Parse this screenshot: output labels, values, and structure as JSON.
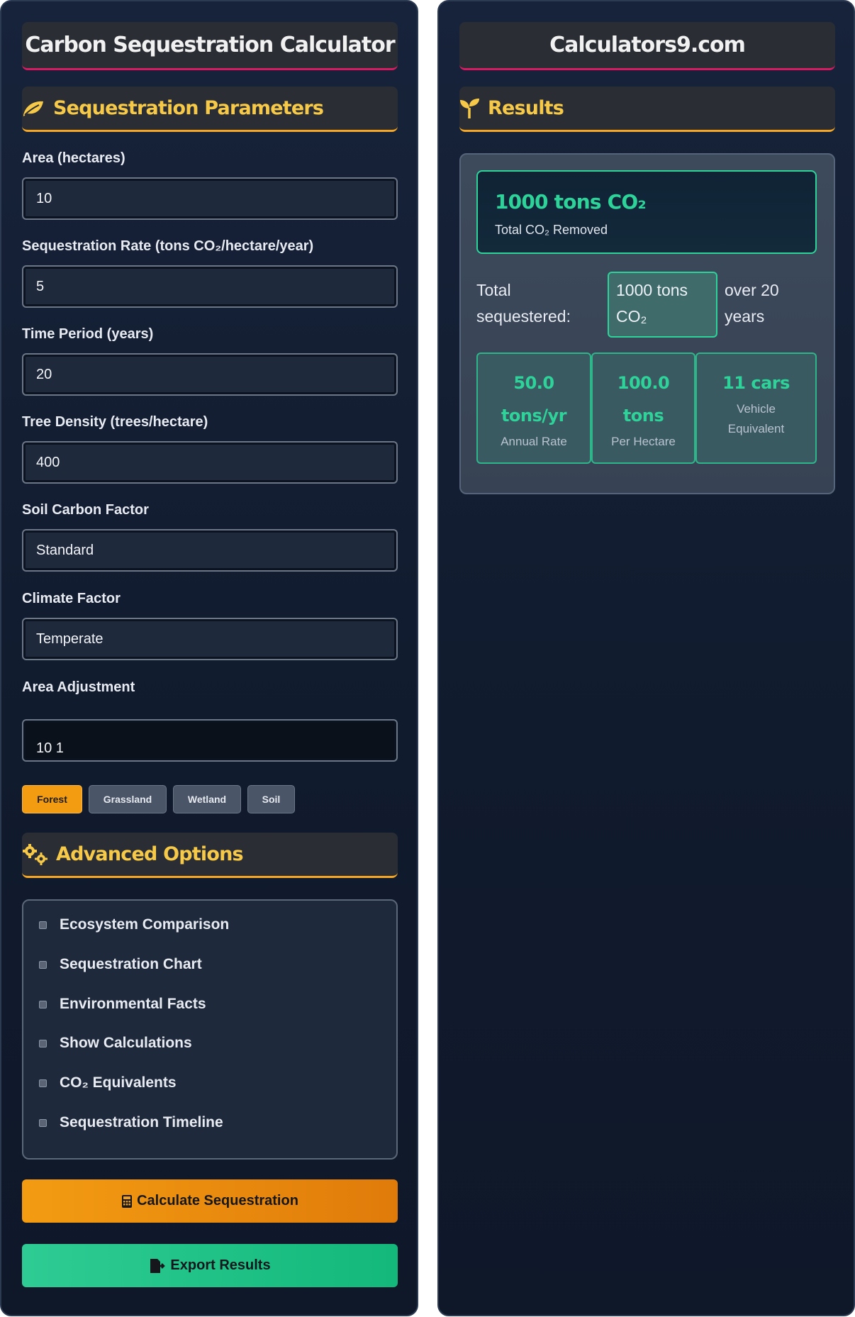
{
  "left": {
    "title": "Carbon Sequestration Calculator",
    "params_heading": "Sequestration Parameters",
    "fields": [
      {
        "label": "Area (hectares)",
        "value": "10"
      },
      {
        "label": "Sequestration Rate (tons CO₂/hectare/year)",
        "value": "5"
      },
      {
        "label": "Time Period (years)",
        "value": "20"
      },
      {
        "label": "Tree Density (trees/hectare)",
        "value": "400"
      },
      {
        "label": "Soil Carbon Factor",
        "value": "Standard"
      },
      {
        "label": "Climate Factor",
        "value": "Temperate"
      }
    ],
    "area_adjustment": {
      "label": "Area Adjustment",
      "value": "10 1"
    },
    "ecosystems": [
      "Forest",
      "Grassland",
      "Wetland",
      "Soil"
    ],
    "advanced_heading": "Advanced Options",
    "options": [
      "Ecosystem Comparison",
      "Sequestration Chart",
      "Environmental Facts",
      "Show Calculations",
      "CO₂ Equivalents",
      "Sequestration Timeline"
    ],
    "calculate_label": "Calculate Sequestration",
    "export_label": "Export Results"
  },
  "right": {
    "title": "Calculators9.com",
    "results_heading": "Results",
    "main_value": "1000 tons CO₂",
    "main_label": "Total CO₂ Removed",
    "summary_prefix_1": "Total",
    "summary_prefix_2": "sequestered:",
    "summary_highlight_1": "1000 tons",
    "summary_highlight_2": "CO₂",
    "summary_suffix_1": "over 20",
    "summary_suffix_2": "years",
    "stats": [
      {
        "value_1": "50.0",
        "value_2": "tons/yr",
        "label_1": "Annual Rate",
        "label_2": ""
      },
      {
        "value_1": "100.0",
        "value_2": "tons",
        "label_1": "Per Hectare",
        "label_2": ""
      },
      {
        "value_1": "11 cars",
        "value_2": "",
        "label_1": "Vehicle",
        "label_2": "Equivalent"
      }
    ]
  },
  "colors": {
    "accent_orange": "#f39c12",
    "accent_green": "#2ed39a",
    "heading_yellow": "#f7c948",
    "title_underline": "#d81b60"
  }
}
